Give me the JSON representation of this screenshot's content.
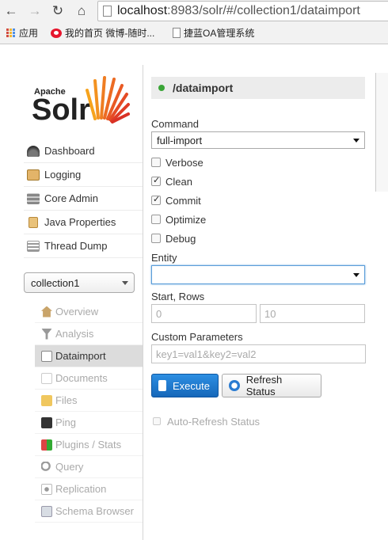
{
  "browser": {
    "url_host": "localhost:8983/solr/#/collection1/dataimport",
    "url_host_part": "localhost",
    "url_rest": ":8983/solr/#/collection1/dataimport",
    "bookmarks": [
      "应用",
      "我的首页 微博-随时...",
      "捷蓝OA管理系统"
    ]
  },
  "logo": {
    "small": "Apache",
    "big": "Solr"
  },
  "nav": {
    "dashboard": "Dashboard",
    "logging": "Logging",
    "core_admin": "Core Admin",
    "java_properties": "Java Properties",
    "thread_dump": "Thread Dump"
  },
  "core_selector": {
    "value": "collection1"
  },
  "core_menu": {
    "overview": "Overview",
    "analysis": "Analysis",
    "dataimport": "Dataimport",
    "documents": "Documents",
    "files": "Files",
    "ping": "Ping",
    "plugins": "Plugins / Stats",
    "query": "Query",
    "replication": "Replication",
    "schema_browser": "Schema Browser"
  },
  "dataimport": {
    "title": "/dataimport",
    "command_label": "Command",
    "command_value": "full-import",
    "options": {
      "verbose": "Verbose",
      "clean": "Clean",
      "commit": "Commit",
      "optimize": "Optimize",
      "debug": "Debug"
    },
    "entity_label": "Entity",
    "start_rows_label": "Start, Rows",
    "start_placeholder": "0",
    "rows_placeholder": "10",
    "custom_label": "Custom Parameters",
    "custom_placeholder": "key1=val1&key2=val2",
    "execute": "Execute",
    "refresh": "Refresh Status",
    "auto_refresh": "Auto-Refresh Status"
  }
}
